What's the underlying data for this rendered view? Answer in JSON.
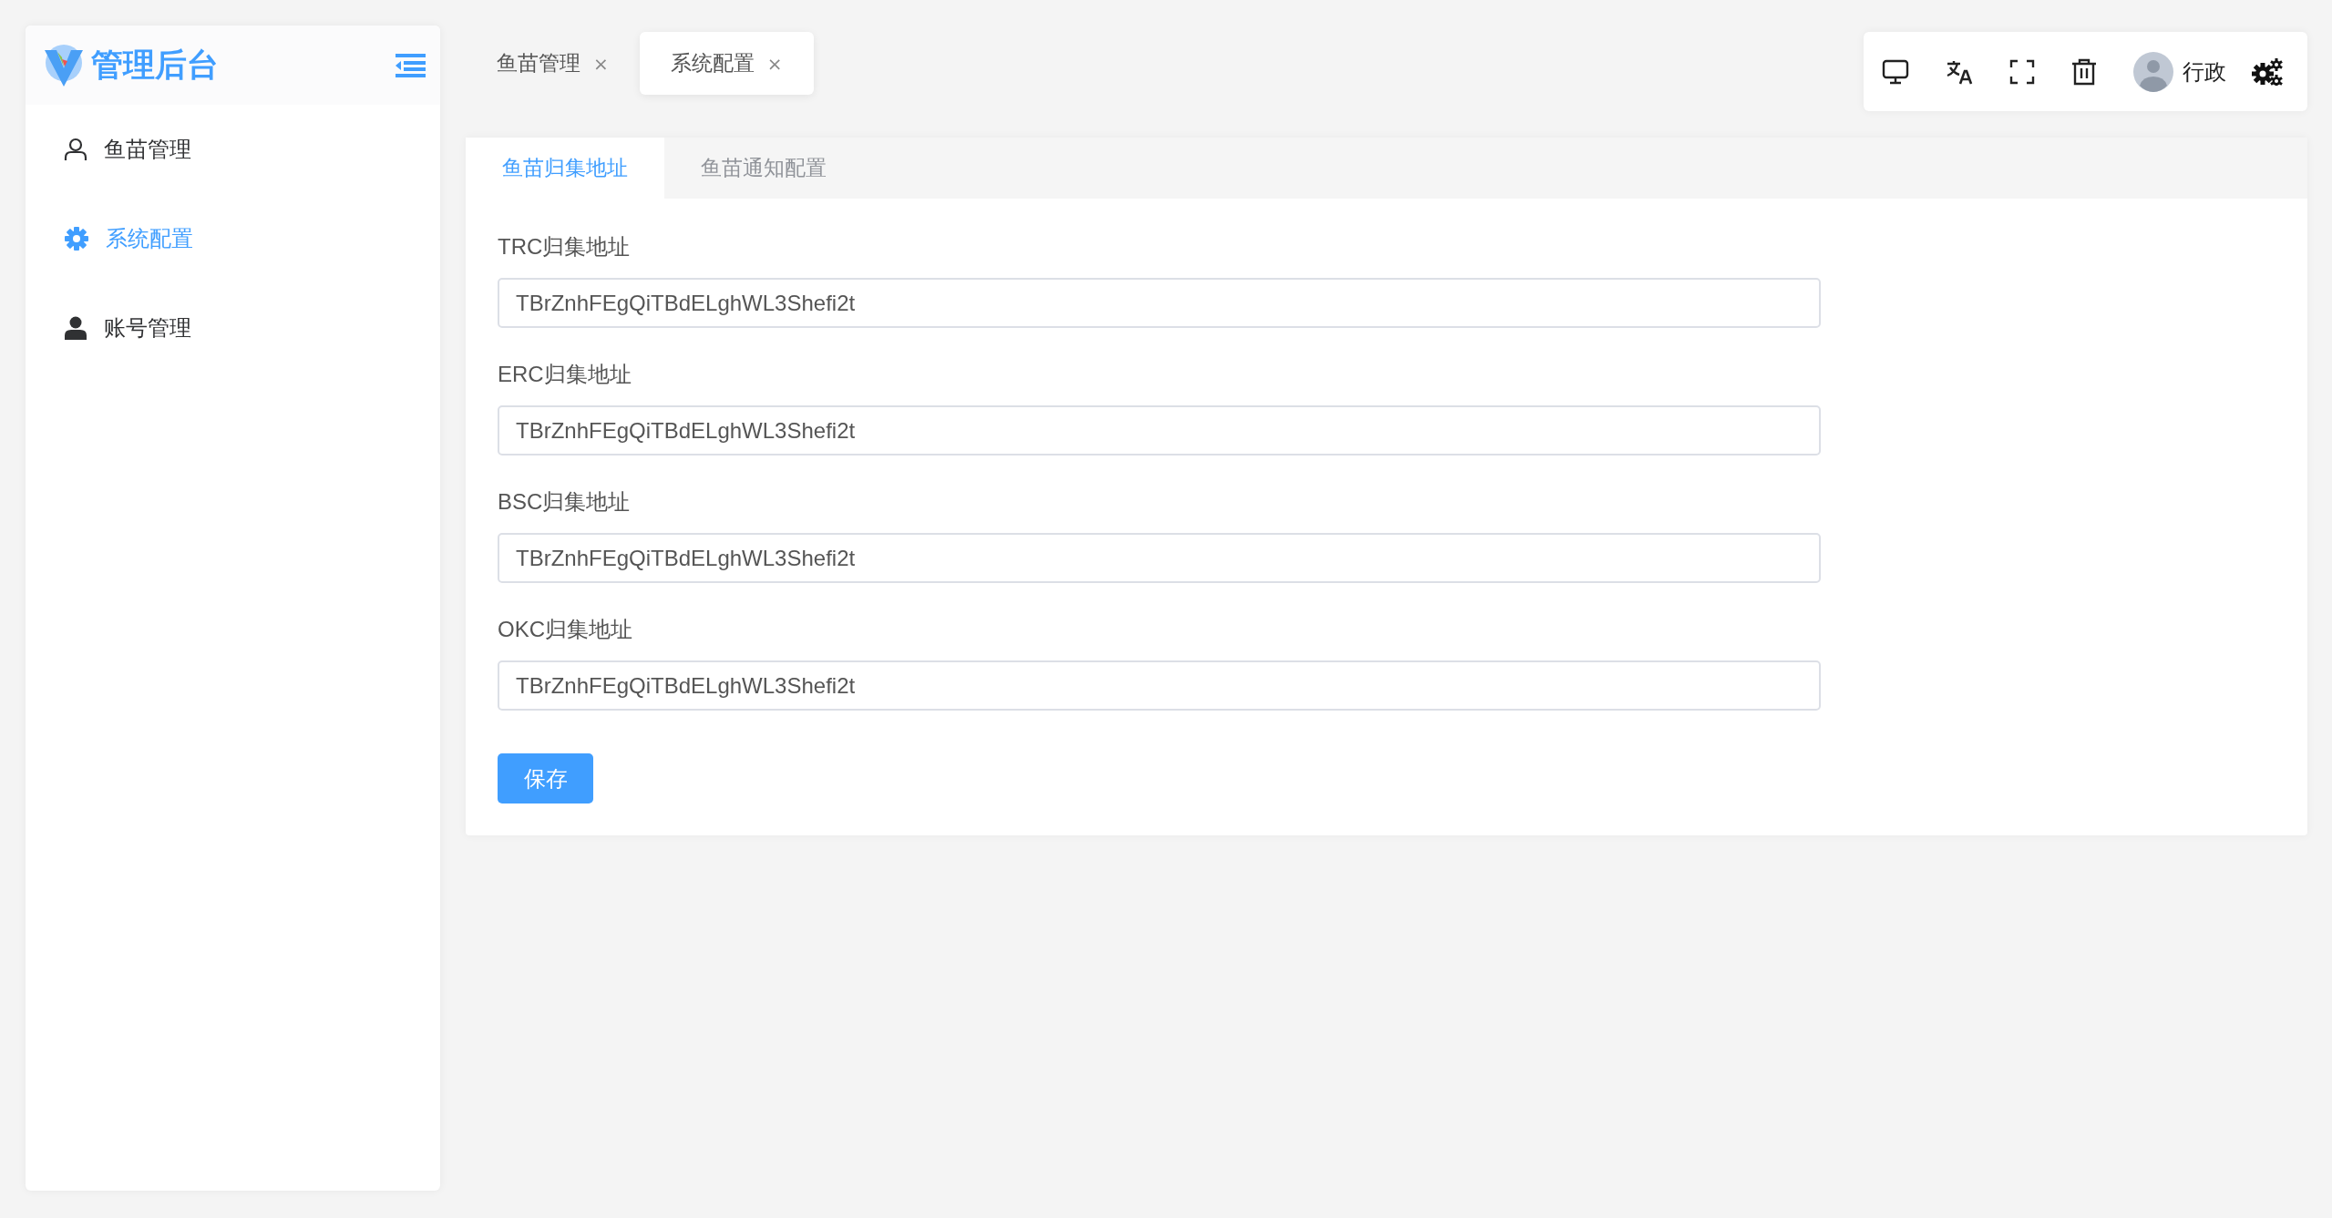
{
  "sidebar": {
    "title": "管理后台",
    "items": [
      {
        "label": "鱼苗管理",
        "kind": "outline",
        "selected": false
      },
      {
        "label": "系统配置",
        "kind": "gear",
        "selected": true
      },
      {
        "label": "账号管理",
        "kind": "solid",
        "selected": false
      }
    ]
  },
  "page_tabs": [
    {
      "label": "鱼苗管理",
      "close": "×",
      "selected": false
    },
    {
      "label": "系统配置",
      "close": "×",
      "selected": true
    }
  ],
  "toolbar": {
    "user": "行政"
  },
  "card": {
    "tabs": [
      {
        "label": "鱼苗归集地址",
        "selected": true
      },
      {
        "label": "鱼苗通知配置",
        "selected": false
      }
    ],
    "fields": [
      {
        "label": "TRC归集地址",
        "value": "TBrZnhFEgQiTBdELghWL3Shefi2t"
      },
      {
        "label": "ERC归集地址",
        "value": "TBrZnhFEgQiTBdELghWL3Shefi2t"
      },
      {
        "label": "BSC归集地址",
        "value": "TBrZnhFEgQiTBdELghWL3Shefi2t"
      },
      {
        "label": "OKC归集地址",
        "value": "TBrZnhFEgQiTBdELghWL3Shefi2t"
      }
    ],
    "save_button": "保存"
  }
}
